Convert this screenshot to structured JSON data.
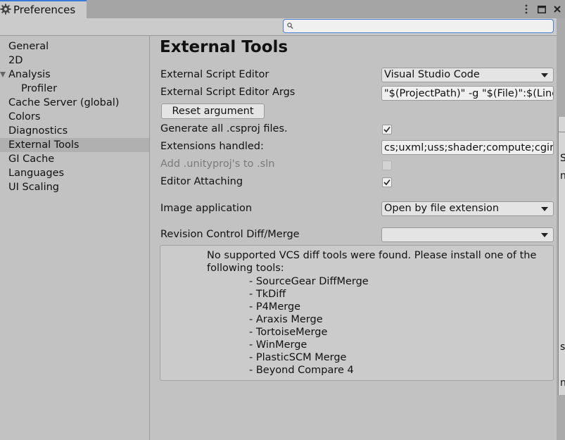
{
  "window": {
    "tab_title": "Preferences",
    "menu_icon": "kebab-menu-icon",
    "maximize_icon": "maximize-icon",
    "close_icon": "close-icon"
  },
  "search": {
    "placeholder": "",
    "value": ""
  },
  "sidebar": {
    "items": [
      {
        "label": "General"
      },
      {
        "label": "2D"
      },
      {
        "label": "Analysis",
        "expanded": true
      },
      {
        "label": "Profiler",
        "indent": 1
      },
      {
        "label": "Cache Server (global)"
      },
      {
        "label": "Colors"
      },
      {
        "label": "Diagnostics"
      },
      {
        "label": "External Tools",
        "selected": true
      },
      {
        "label": "GI Cache"
      },
      {
        "label": "Languages"
      },
      {
        "label": "UI Scaling"
      }
    ]
  },
  "main": {
    "title": "External Tools",
    "external_script_editor": {
      "label": "External Script Editor",
      "value": "Visual Studio Code"
    },
    "external_script_editor_args": {
      "label": "External Script Editor Args",
      "value": "\"$(ProjectPath)\" -g \"$(File)\":$(Line)"
    },
    "reset_argument": {
      "label": "Reset argument"
    },
    "generate_csproj": {
      "label": "Generate all .csproj files.",
      "checked": true
    },
    "extensions_handled": {
      "label": "Extensions handled:",
      "value": "cs;uxml;uss;shader;compute;cginc"
    },
    "add_unityproj": {
      "label": "Add .unityproj's to .sln",
      "checked": false,
      "disabled": true
    },
    "editor_attaching": {
      "label": "Editor Attaching",
      "checked": true
    },
    "image_application": {
      "label": "Image application",
      "value": "Open by file extension"
    },
    "revision_control": {
      "label": "Revision Control Diff/Merge",
      "value": ""
    },
    "vcs_help": {
      "message": "No supported VCS diff tools were found. Please install one of the following tools:",
      "tools": [
        "- SourceGear DiffMerge",
        "- TkDiff",
        "- P4Merge",
        "- Araxis Merge",
        "- TortoiseMerge",
        "- WinMerge",
        "- PlasticSCM Merge",
        "- Beyond Compare 4"
      ]
    }
  },
  "background_window": {
    "fragments": [
      "S",
      "np",
      "s/S",
      "n E"
    ]
  },
  "colors": {
    "accent": "#3a79d8",
    "selected_row": "#b0b0b0",
    "panel": "#c2c2c2"
  }
}
